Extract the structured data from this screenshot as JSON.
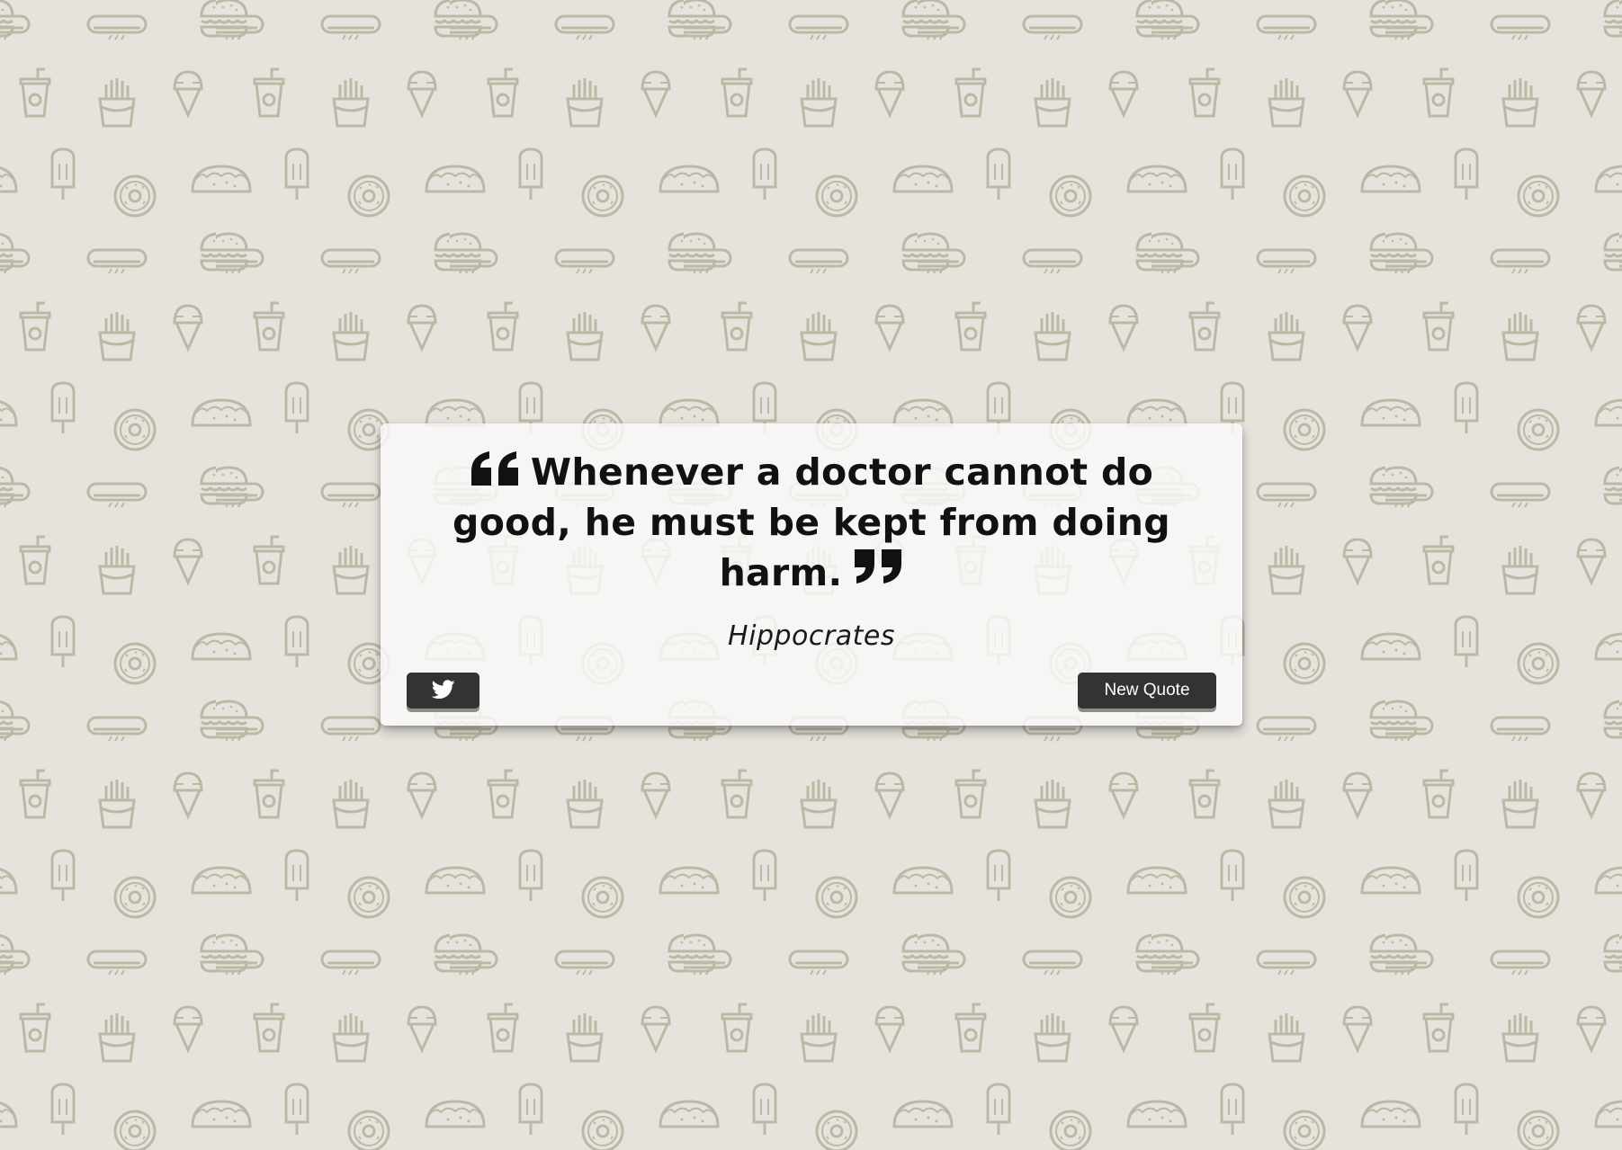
{
  "page": {
    "background_color": "#e6e3dc",
    "pattern_color": "#bdb8a6",
    "pattern_icons": [
      "hamburger-icon",
      "hotdog-icon",
      "soda-cup-icon",
      "fries-icon",
      "ice-cream-cone-icon",
      "popsicle-icon",
      "donut-icon",
      "taco-icon"
    ]
  },
  "quote_box": {
    "quote_text": "Whenever a doctor cannot do good, he must be kept from doing harm.",
    "author": "Hippocrates",
    "open_quote_icon": "quote-left-icon",
    "close_quote_icon": "quote-right-icon"
  },
  "actions": {
    "tweet_icon": "twitter-icon",
    "new_quote_label": "New Quote",
    "button_color": "#333333"
  }
}
